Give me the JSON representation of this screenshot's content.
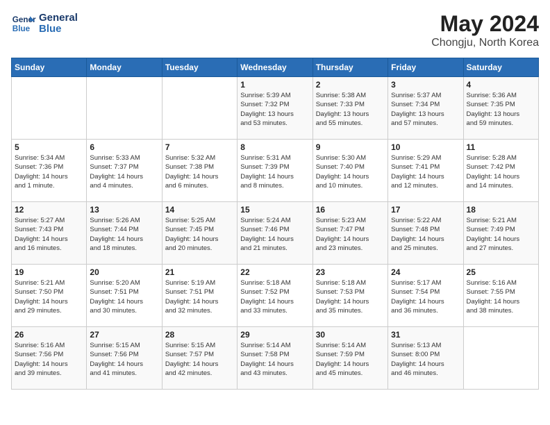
{
  "logo": {
    "line1": "General",
    "line2": "Blue"
  },
  "title": "May 2024",
  "subtitle": "Chongju, North Korea",
  "days_of_week": [
    "Sunday",
    "Monday",
    "Tuesday",
    "Wednesday",
    "Thursday",
    "Friday",
    "Saturday"
  ],
  "weeks": [
    [
      {
        "day": "",
        "info": ""
      },
      {
        "day": "",
        "info": ""
      },
      {
        "day": "",
        "info": ""
      },
      {
        "day": "1",
        "info": "Sunrise: 5:39 AM\nSunset: 7:32 PM\nDaylight: 13 hours\nand 53 minutes."
      },
      {
        "day": "2",
        "info": "Sunrise: 5:38 AM\nSunset: 7:33 PM\nDaylight: 13 hours\nand 55 minutes."
      },
      {
        "day": "3",
        "info": "Sunrise: 5:37 AM\nSunset: 7:34 PM\nDaylight: 13 hours\nand 57 minutes."
      },
      {
        "day": "4",
        "info": "Sunrise: 5:36 AM\nSunset: 7:35 PM\nDaylight: 13 hours\nand 59 minutes."
      }
    ],
    [
      {
        "day": "5",
        "info": "Sunrise: 5:34 AM\nSunset: 7:36 PM\nDaylight: 14 hours\nand 1 minute."
      },
      {
        "day": "6",
        "info": "Sunrise: 5:33 AM\nSunset: 7:37 PM\nDaylight: 14 hours\nand 4 minutes."
      },
      {
        "day": "7",
        "info": "Sunrise: 5:32 AM\nSunset: 7:38 PM\nDaylight: 14 hours\nand 6 minutes."
      },
      {
        "day": "8",
        "info": "Sunrise: 5:31 AM\nSunset: 7:39 PM\nDaylight: 14 hours\nand 8 minutes."
      },
      {
        "day": "9",
        "info": "Sunrise: 5:30 AM\nSunset: 7:40 PM\nDaylight: 14 hours\nand 10 minutes."
      },
      {
        "day": "10",
        "info": "Sunrise: 5:29 AM\nSunset: 7:41 PM\nDaylight: 14 hours\nand 12 minutes."
      },
      {
        "day": "11",
        "info": "Sunrise: 5:28 AM\nSunset: 7:42 PM\nDaylight: 14 hours\nand 14 minutes."
      }
    ],
    [
      {
        "day": "12",
        "info": "Sunrise: 5:27 AM\nSunset: 7:43 PM\nDaylight: 14 hours\nand 16 minutes."
      },
      {
        "day": "13",
        "info": "Sunrise: 5:26 AM\nSunset: 7:44 PM\nDaylight: 14 hours\nand 18 minutes."
      },
      {
        "day": "14",
        "info": "Sunrise: 5:25 AM\nSunset: 7:45 PM\nDaylight: 14 hours\nand 20 minutes."
      },
      {
        "day": "15",
        "info": "Sunrise: 5:24 AM\nSunset: 7:46 PM\nDaylight: 14 hours\nand 21 minutes."
      },
      {
        "day": "16",
        "info": "Sunrise: 5:23 AM\nSunset: 7:47 PM\nDaylight: 14 hours\nand 23 minutes."
      },
      {
        "day": "17",
        "info": "Sunrise: 5:22 AM\nSunset: 7:48 PM\nDaylight: 14 hours\nand 25 minutes."
      },
      {
        "day": "18",
        "info": "Sunrise: 5:21 AM\nSunset: 7:49 PM\nDaylight: 14 hours\nand 27 minutes."
      }
    ],
    [
      {
        "day": "19",
        "info": "Sunrise: 5:21 AM\nSunset: 7:50 PM\nDaylight: 14 hours\nand 29 minutes."
      },
      {
        "day": "20",
        "info": "Sunrise: 5:20 AM\nSunset: 7:51 PM\nDaylight: 14 hours\nand 30 minutes."
      },
      {
        "day": "21",
        "info": "Sunrise: 5:19 AM\nSunset: 7:51 PM\nDaylight: 14 hours\nand 32 minutes."
      },
      {
        "day": "22",
        "info": "Sunrise: 5:18 AM\nSunset: 7:52 PM\nDaylight: 14 hours\nand 33 minutes."
      },
      {
        "day": "23",
        "info": "Sunrise: 5:18 AM\nSunset: 7:53 PM\nDaylight: 14 hours\nand 35 minutes."
      },
      {
        "day": "24",
        "info": "Sunrise: 5:17 AM\nSunset: 7:54 PM\nDaylight: 14 hours\nand 36 minutes."
      },
      {
        "day": "25",
        "info": "Sunrise: 5:16 AM\nSunset: 7:55 PM\nDaylight: 14 hours\nand 38 minutes."
      }
    ],
    [
      {
        "day": "26",
        "info": "Sunrise: 5:16 AM\nSunset: 7:56 PM\nDaylight: 14 hours\nand 39 minutes."
      },
      {
        "day": "27",
        "info": "Sunrise: 5:15 AM\nSunset: 7:56 PM\nDaylight: 14 hours\nand 41 minutes."
      },
      {
        "day": "28",
        "info": "Sunrise: 5:15 AM\nSunset: 7:57 PM\nDaylight: 14 hours\nand 42 minutes."
      },
      {
        "day": "29",
        "info": "Sunrise: 5:14 AM\nSunset: 7:58 PM\nDaylight: 14 hours\nand 43 minutes."
      },
      {
        "day": "30",
        "info": "Sunrise: 5:14 AM\nSunset: 7:59 PM\nDaylight: 14 hours\nand 45 minutes."
      },
      {
        "day": "31",
        "info": "Sunrise: 5:13 AM\nSunset: 8:00 PM\nDaylight: 14 hours\nand 46 minutes."
      },
      {
        "day": "",
        "info": ""
      }
    ]
  ]
}
